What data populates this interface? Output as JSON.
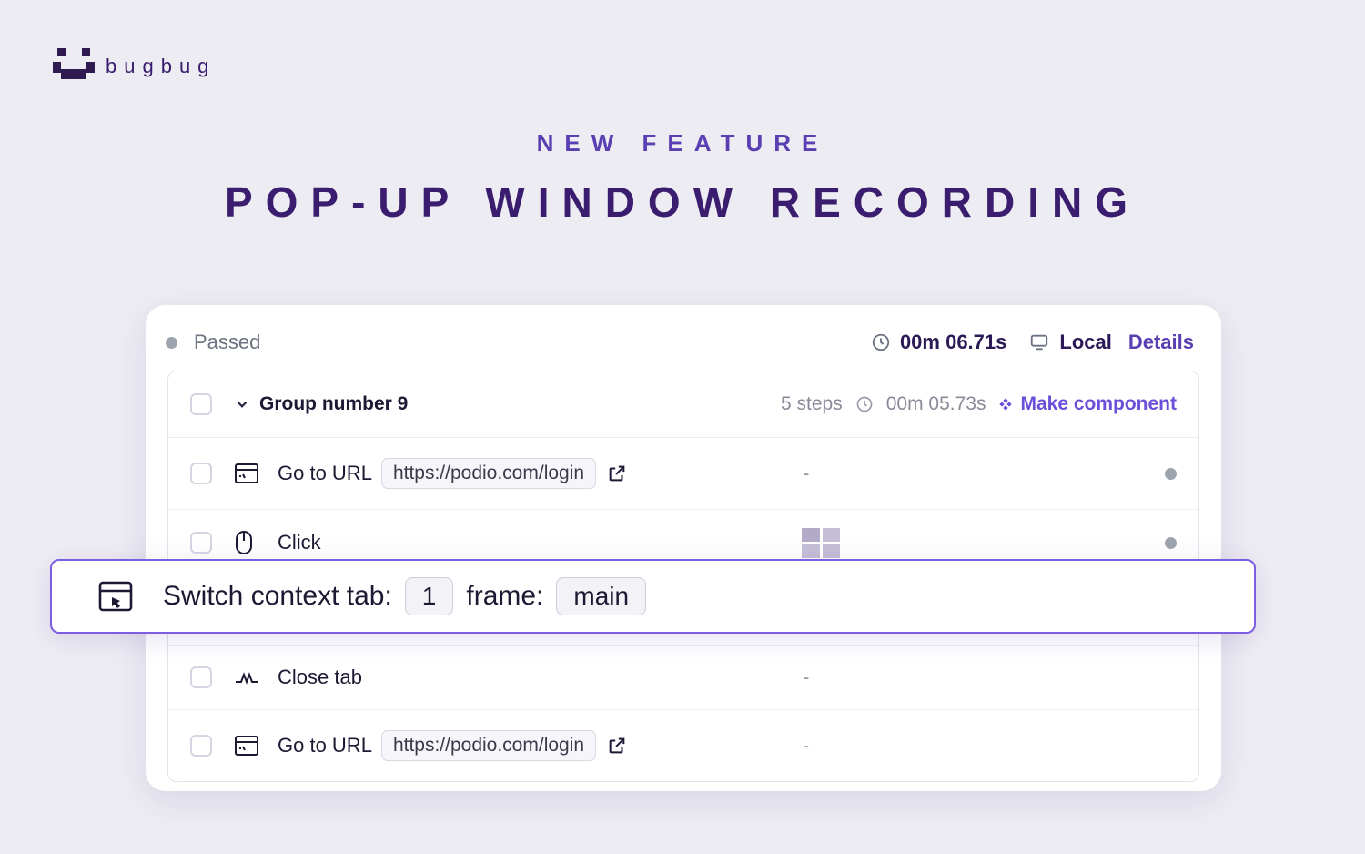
{
  "brand": {
    "name": "bugbug"
  },
  "hero": {
    "eyebrow": "NEW FEATURE",
    "headline": "POP-UP WINDOW RECORDING"
  },
  "run": {
    "status": "Passed",
    "duration": "00m 06.71s",
    "environment": "Local",
    "details_label": "Details"
  },
  "group": {
    "title": "Group number 9",
    "steps_label": "5 steps",
    "duration": "00m 05.73s",
    "make_component_label": "Make component"
  },
  "steps": [
    {
      "type": "goto",
      "label": "Go to URL",
      "url": "https://podio.com/login",
      "result": "-"
    },
    {
      "type": "click",
      "label": "Click",
      "result": ""
    },
    {
      "type": "close_tab",
      "label": "Close tab",
      "result": "-"
    },
    {
      "type": "goto",
      "label": "Go to URL",
      "url": "https://podio.com/login",
      "result": "-"
    }
  ],
  "callout": {
    "prefix": "Switch context tab:",
    "tab_value": "1",
    "frame_label": "frame:",
    "frame_value": "main"
  }
}
